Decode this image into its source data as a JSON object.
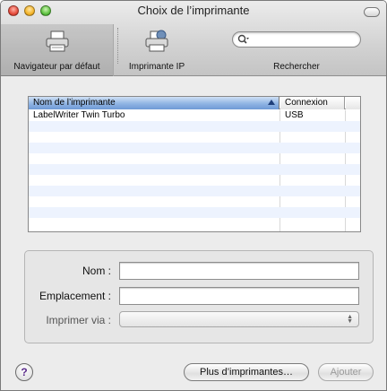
{
  "window": {
    "title": "Choix de l’imprimante"
  },
  "toolbar": {
    "default_browser_label": "Navigateur par défaut",
    "ip_printer_label": "Imprimante IP",
    "search_label": "Rechercher"
  },
  "printer_list": {
    "columns": [
      "Nom de l’imprimante",
      "Connexion"
    ],
    "rows": [
      {
        "name": "LabelWriter Twin Turbo",
        "connection": "USB"
      }
    ]
  },
  "details": {
    "name_label": "Nom :",
    "location_label": "Emplacement :",
    "print_via_label": "Imprimer via :",
    "name_value": "",
    "location_value": "",
    "print_via_value": ""
  },
  "buttons": {
    "help": "?",
    "more_printers": "Plus d’imprimantes…",
    "add": "Ajouter"
  }
}
